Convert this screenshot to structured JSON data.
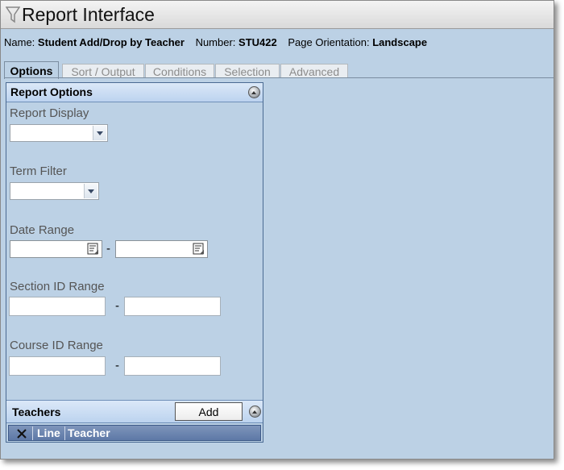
{
  "window": {
    "title": "Report Interface",
    "title_icon": "funnel-icon"
  },
  "info": {
    "name_label": "Name:",
    "name_value": "Student Add/Drop by Teacher",
    "number_label": "Number:",
    "number_value": "STU422",
    "orientation_label": "Page Orientation:",
    "orientation_value": "Landscape"
  },
  "tabs": [
    {
      "label": "Options",
      "active": true
    },
    {
      "label": "Sort / Output",
      "active": false
    },
    {
      "label": "Conditions",
      "active": false
    },
    {
      "label": "Selection",
      "active": false
    },
    {
      "label": "Advanced",
      "active": false
    }
  ],
  "panel": {
    "title": "Report Options",
    "fields": {
      "report_display_label": "Report Display",
      "report_display_value": "",
      "term_filter_label": "Term Filter",
      "term_filter_value": "",
      "date_range_label": "Date Range",
      "date_from": "",
      "date_to": "",
      "section_id_label": "Section ID Range",
      "section_from": "",
      "section_to": "",
      "course_id_label": "Course ID Range",
      "course_from": "",
      "course_to": "",
      "range_separator": "-"
    }
  },
  "teachers": {
    "title": "Teachers",
    "add_label": "Add",
    "columns": [
      "Line",
      "Teacher"
    ],
    "delete_column_icon": "x-icon"
  },
  "colors": {
    "window_bg": "#bcd1e5",
    "panel_border": "#4a6a92",
    "grid_header": "#5d78a6"
  }
}
